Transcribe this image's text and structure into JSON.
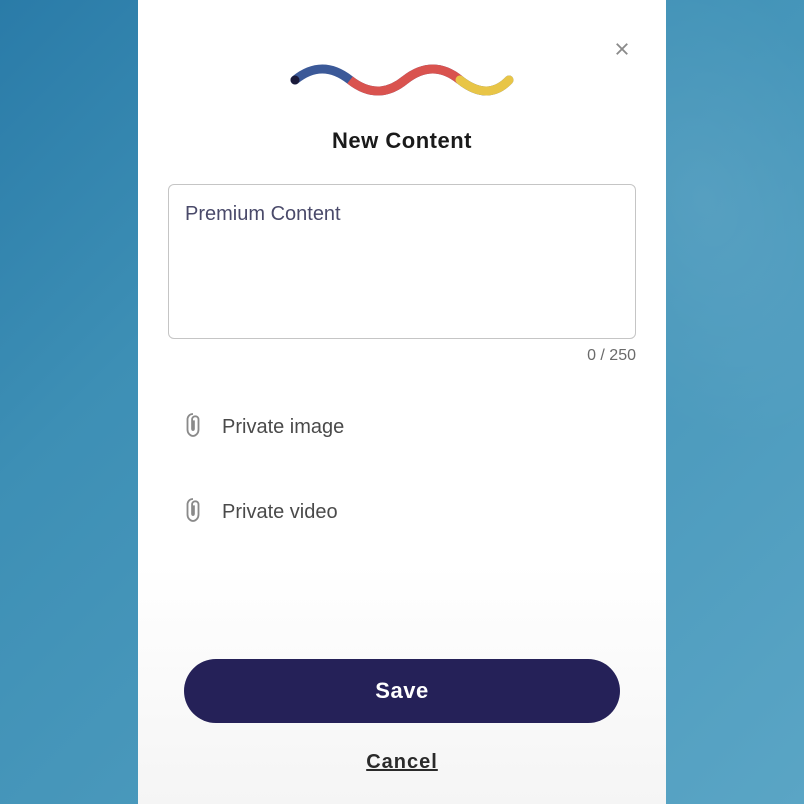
{
  "dialog": {
    "title": "New Content",
    "input_placeholder": "Premium Content",
    "input_value": "",
    "char_count": "0 / 250",
    "attachments": {
      "image_label": "Private image",
      "video_label": "Private video"
    },
    "save_label": "Save",
    "cancel_label": "Cancel"
  },
  "colors": {
    "primary": "#252158",
    "wave_blue": "#3b5998",
    "wave_red": "#d9534f",
    "wave_yellow": "#e8c547"
  }
}
